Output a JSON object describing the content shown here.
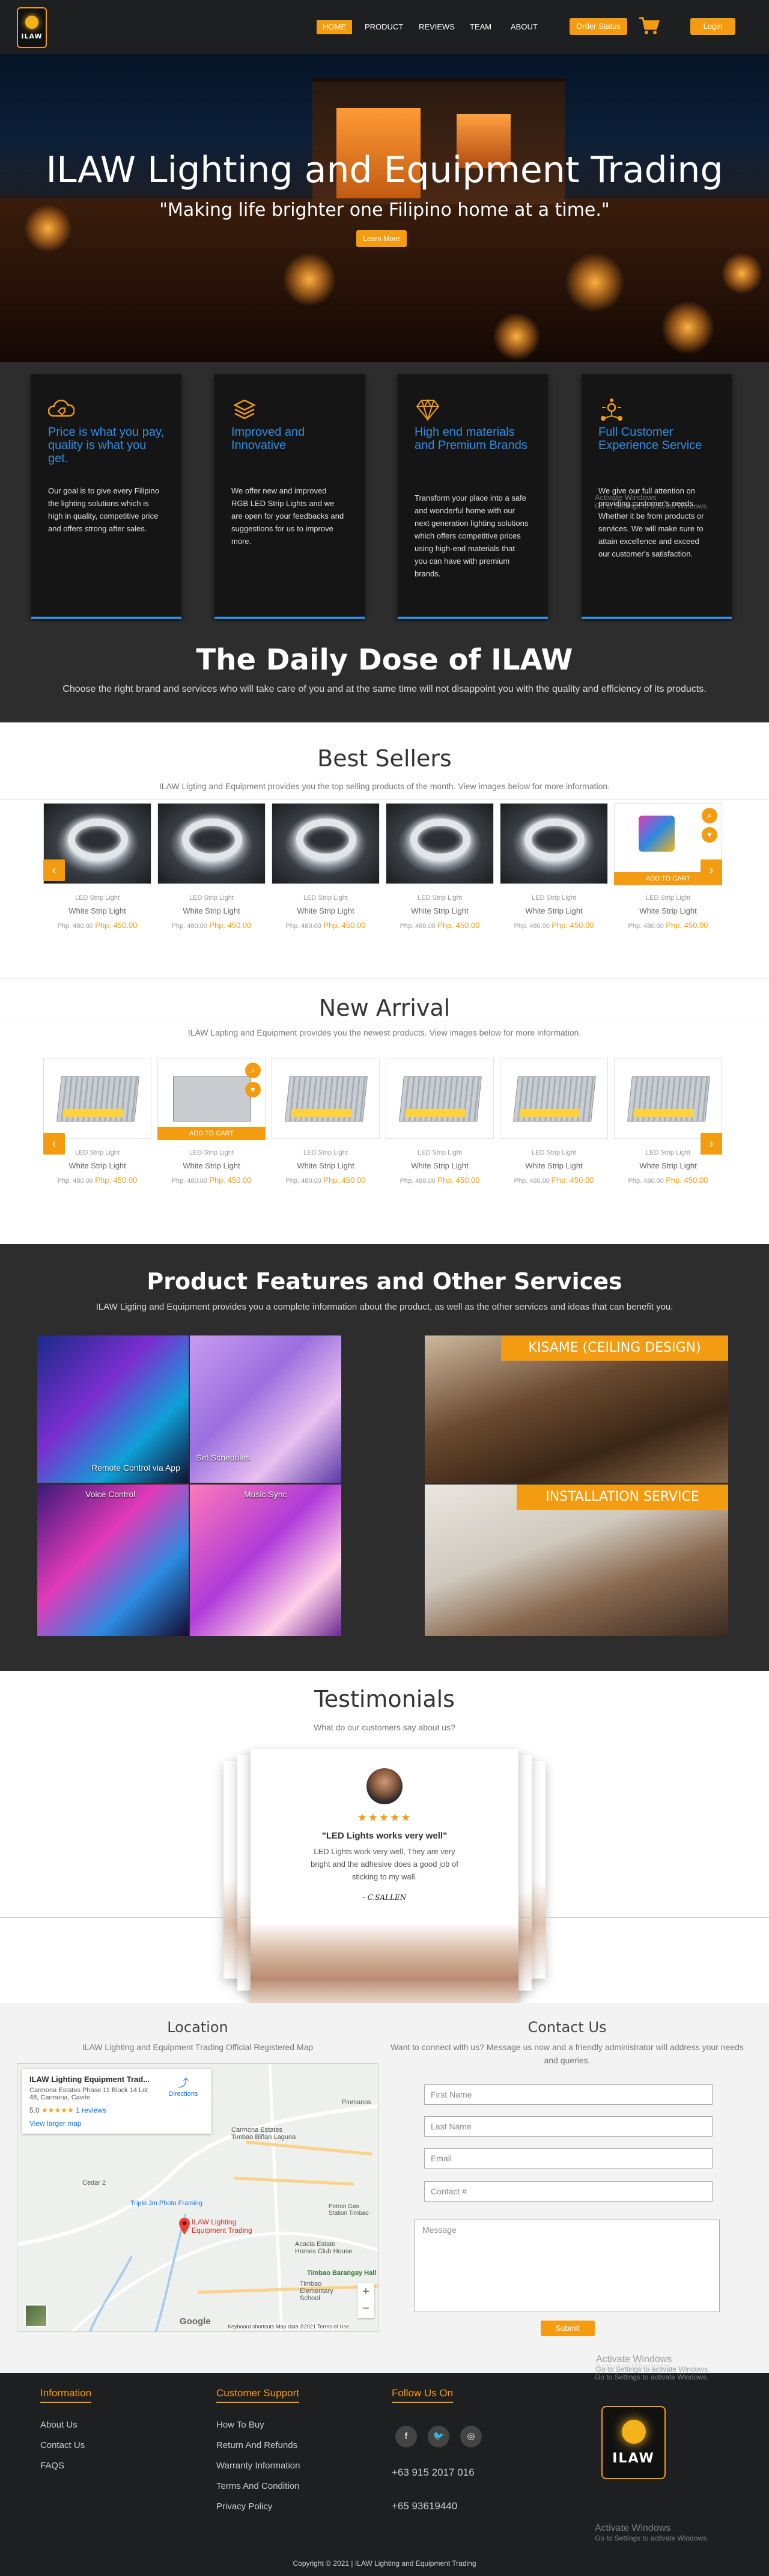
{
  "nav": {
    "logo_text": "ILAW",
    "links": [
      "HOME",
      "PRODUCT",
      "REVIEWS",
      "TEAM",
      "ABOUT"
    ],
    "order_status": "Order Status",
    "login": "Login"
  },
  "hero": {
    "title": "ILAW Lighting and Equipment Trading",
    "subtitle": "\"Making life brighter one Filipino home at a time.\"",
    "cta": "Learn More"
  },
  "features": [
    {
      "icon": "tag-cloud-icon",
      "title": "Price is what you pay, quality is what you get.",
      "text": "Our goal is to give every Filipino the lighting solutions which is high in quality, competitive price and offers strong after sales."
    },
    {
      "icon": "layers-icon",
      "title": "Improved and Innovative",
      "text": "We offer new and improved RGB LED Strip Lights and we are open for your feedbacks and suggestions for us to improve more."
    },
    {
      "icon": "diamond-icon",
      "title": "High end materials and Premium Brands",
      "text": "Transform your place into a safe and wonderful home with our next generation lighting solutions which offers competitive prices using high-end materials that you can have with premium brands."
    },
    {
      "icon": "network-icon",
      "title": "Full Customer Experience Service",
      "text": "We give our full attention on providing customer's needs. Whether it be from products or services. We will make sure to attain excellence and exceed our customer's satisfaction."
    }
  ],
  "daily": {
    "title": "The Daily Dose of ILAW",
    "subtitle": "Choose the right brand and services who will take care of you and at the same time will not disappoint you with the quality and efficiency of its products."
  },
  "best_sellers": {
    "title": "Best Sellers",
    "subtitle": "ILAW Ligting and Equipment provides you the top selling products of the month. View images below for more information.",
    "product": {
      "category": "LED Strip Light",
      "name": "White Strip Light",
      "old_price": "Php. 480.00",
      "new_price": "Php. 450.00"
    },
    "add_to_cart": "ADD TO CART"
  },
  "new_arrival": {
    "title": "New Arrival",
    "subtitle": "ILAW Lapting and Equipment provides you the newest products. View images below for more information.",
    "product": {
      "category": "LED Strip Light",
      "name": "White Strip Light",
      "old_price": "Php. 480.00",
      "new_price": "Php. 450.00"
    },
    "add_to_cart": "ADD TO CART"
  },
  "product_features": {
    "title": "Product Features and Other Services",
    "subtitle": "ILAW Ligting and Equipment provides you a complete information about the product, as well as the other services and ideas that can benefit you.",
    "tiles": [
      "Remote Control via App",
      "Set Schedules",
      "Voice Control",
      "Music Sync"
    ],
    "services": [
      "KISAME (CEILING DESIGN)",
      "INSTALLATION SERVICE"
    ]
  },
  "testimonials": {
    "title": "Testimonials",
    "subtitle": "What do our customers say about us?",
    "stars": "★★★★★",
    "quote": "\"LED Lights works very well\"",
    "body": "LED Lights work very well, They are very bright and the adhesive does a good job of sticking to my wall.",
    "author": "- C.SALLEN"
  },
  "location": {
    "title": "Location",
    "subtitle": "ILAW Lighting and Equipment Trading Official Registered Map",
    "card_title": "ILAW Lighting Equipment Trad...",
    "card_address": "Carmona Estates Phase 11 Block 14 Lot 48, Carmona, Cavite",
    "rating": "5.0",
    "reviews": "1 reviews",
    "directions": "Directions",
    "larger_map": "View larger map",
    "labels": [
      "Carmona Estates Timbao Biñan Laguna",
      "Cedar 2",
      "Triple Jm Photo Framing",
      "ILAW Lighting Equipment Trading",
      "Petron Gas Station Timbao",
      "Acacia Estate Homes Club House",
      "Timbao Barangay Hall",
      "Timbao Elementary School",
      "Pinmanos"
    ],
    "google": "Google",
    "map_footer": [
      "Keyboard shortcuts",
      "Map data ©2021",
      "Terms of Use"
    ]
  },
  "contact": {
    "title": "Contact Us",
    "subtitle": "Want to connect with us? Message us now and a friendly administrator will address your needs and queries.",
    "placeholders": {
      "first": "First Name",
      "last": "Last Name",
      "email": "Email",
      "phone": "Contact #",
      "message": "Message"
    },
    "submit": "Submit"
  },
  "footer": {
    "information": {
      "title": "Information",
      "links": [
        "About Us",
        "Contact Us",
        "FAQS"
      ]
    },
    "support": {
      "title": "Customer Support",
      "links": [
        "How To Buy",
        "Return And Refunds",
        "Warranty Information",
        "Terms And Condition",
        "Privacy Policy"
      ]
    },
    "follow": {
      "title": "Follow Us On",
      "phones": [
        "+63 915 2017 016",
        "+65 93619440"
      ]
    },
    "logo_text": "ILAW",
    "copyright": "Copyright © 2021 | ILAW Lighting and Equipment Trading"
  },
  "watermark": {
    "title": "Activate Windows",
    "sub": "Go to Settings to activate Windows."
  },
  "colors": {
    "accent": "#f39c12",
    "feature_blue": "#2f8de4",
    "dark": "#2d2d2d",
    "nav": "#1e1f21"
  }
}
